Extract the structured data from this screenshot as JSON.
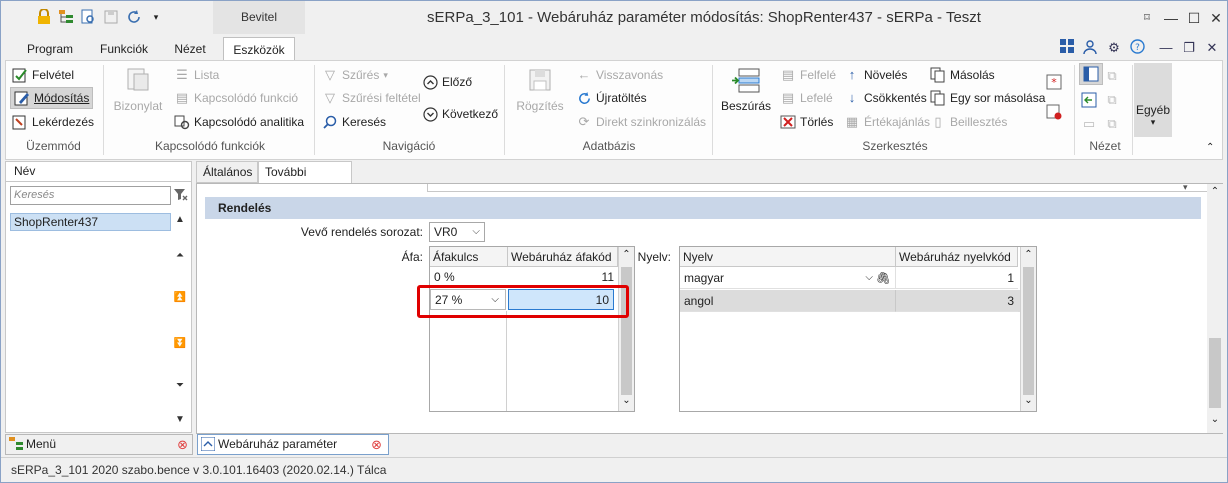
{
  "window": {
    "title": "sERPa_3_101 - Webáruház paraméter módosítás: ShopRenter437 - sERPa - Teszt",
    "context_tab": "Bevitel"
  },
  "menu": {
    "tabs": [
      "Program",
      "Funkciók",
      "Nézet",
      "Eszközök"
    ]
  },
  "ribbon": {
    "uzemmod": {
      "label": "Üzemmód",
      "felvetel": "Felvétel",
      "modositas": "Módosítás",
      "lekerdezes": "Lekérdezés"
    },
    "kapcsolodo": {
      "label": "Kapcsolódó funkciók",
      "bizonylat": "Bizonylat",
      "lista": "Lista",
      "kapcsolodo_funkcio": "Kapcsolódó funkció",
      "kapcsolodo_analitika": "Kapcsolódó analitika"
    },
    "navigacio": {
      "label": "Navigáció",
      "szures": "Szűrés",
      "szuresi_feltetel": "Szűrési feltétel",
      "kereses": "Keresés",
      "elozo": "Előző",
      "kovetkezo": "Következő"
    },
    "adatbazis": {
      "label": "Adatbázis",
      "rogzites": "Rögzítés",
      "visszavonas": "Visszavonás",
      "ujratoltes": "Újratöltés",
      "direkt_szinkronizalas": "Direkt szinkronizálás"
    },
    "szerkesztes": {
      "label": "Szerkesztés",
      "beszuras": "Beszúrás",
      "felfele": "Felfelé",
      "lefele": "Lefelé",
      "torles": "Törlés",
      "noveles": "Növelés",
      "csokkentes": "Csökkentés",
      "ertekajanlas": "Értékajánlás",
      "masolas": "Másolás",
      "egy_sor_masolasa": "Egy sor másolása",
      "beillesztes": "Beillesztés"
    },
    "nezet": {
      "label": "Nézet",
      "egyeb": "Egyéb"
    }
  },
  "left_panel": {
    "header": "Név",
    "search_placeholder": "Keresés",
    "items": [
      "ShopRenter437"
    ]
  },
  "tabs": [
    "Általános",
    "További adatok"
  ],
  "form": {
    "section_title": "Rendelés",
    "vevo_label": "Vevő rendelés sorozat:",
    "vevo_value": "VR0",
    "afa_label": "Áfa:",
    "nyelv_label": "Nyelv:"
  },
  "afa_grid": {
    "columns": [
      "Áfakulcs",
      "Webáruház áfakód"
    ],
    "rows": [
      {
        "kulcs": "0 %",
        "kod": "11"
      },
      {
        "kulcs": "27 %",
        "kod": "10"
      }
    ]
  },
  "nyelv_grid": {
    "columns": [
      "Nyelv",
      "Webáruház nyelvkód"
    ],
    "rows": [
      {
        "nyelv": "magyar",
        "kod": "1"
      },
      {
        "nyelv": "angol",
        "kod": "3"
      }
    ]
  },
  "bottom_tabs": [
    "Menü",
    "Webáruház paraméter"
  ],
  "status": {
    "text": "sERPa_3_101  2020  szabo.bence  v 3.0.101.16403 (2020.02.14.)  Tálca"
  }
}
